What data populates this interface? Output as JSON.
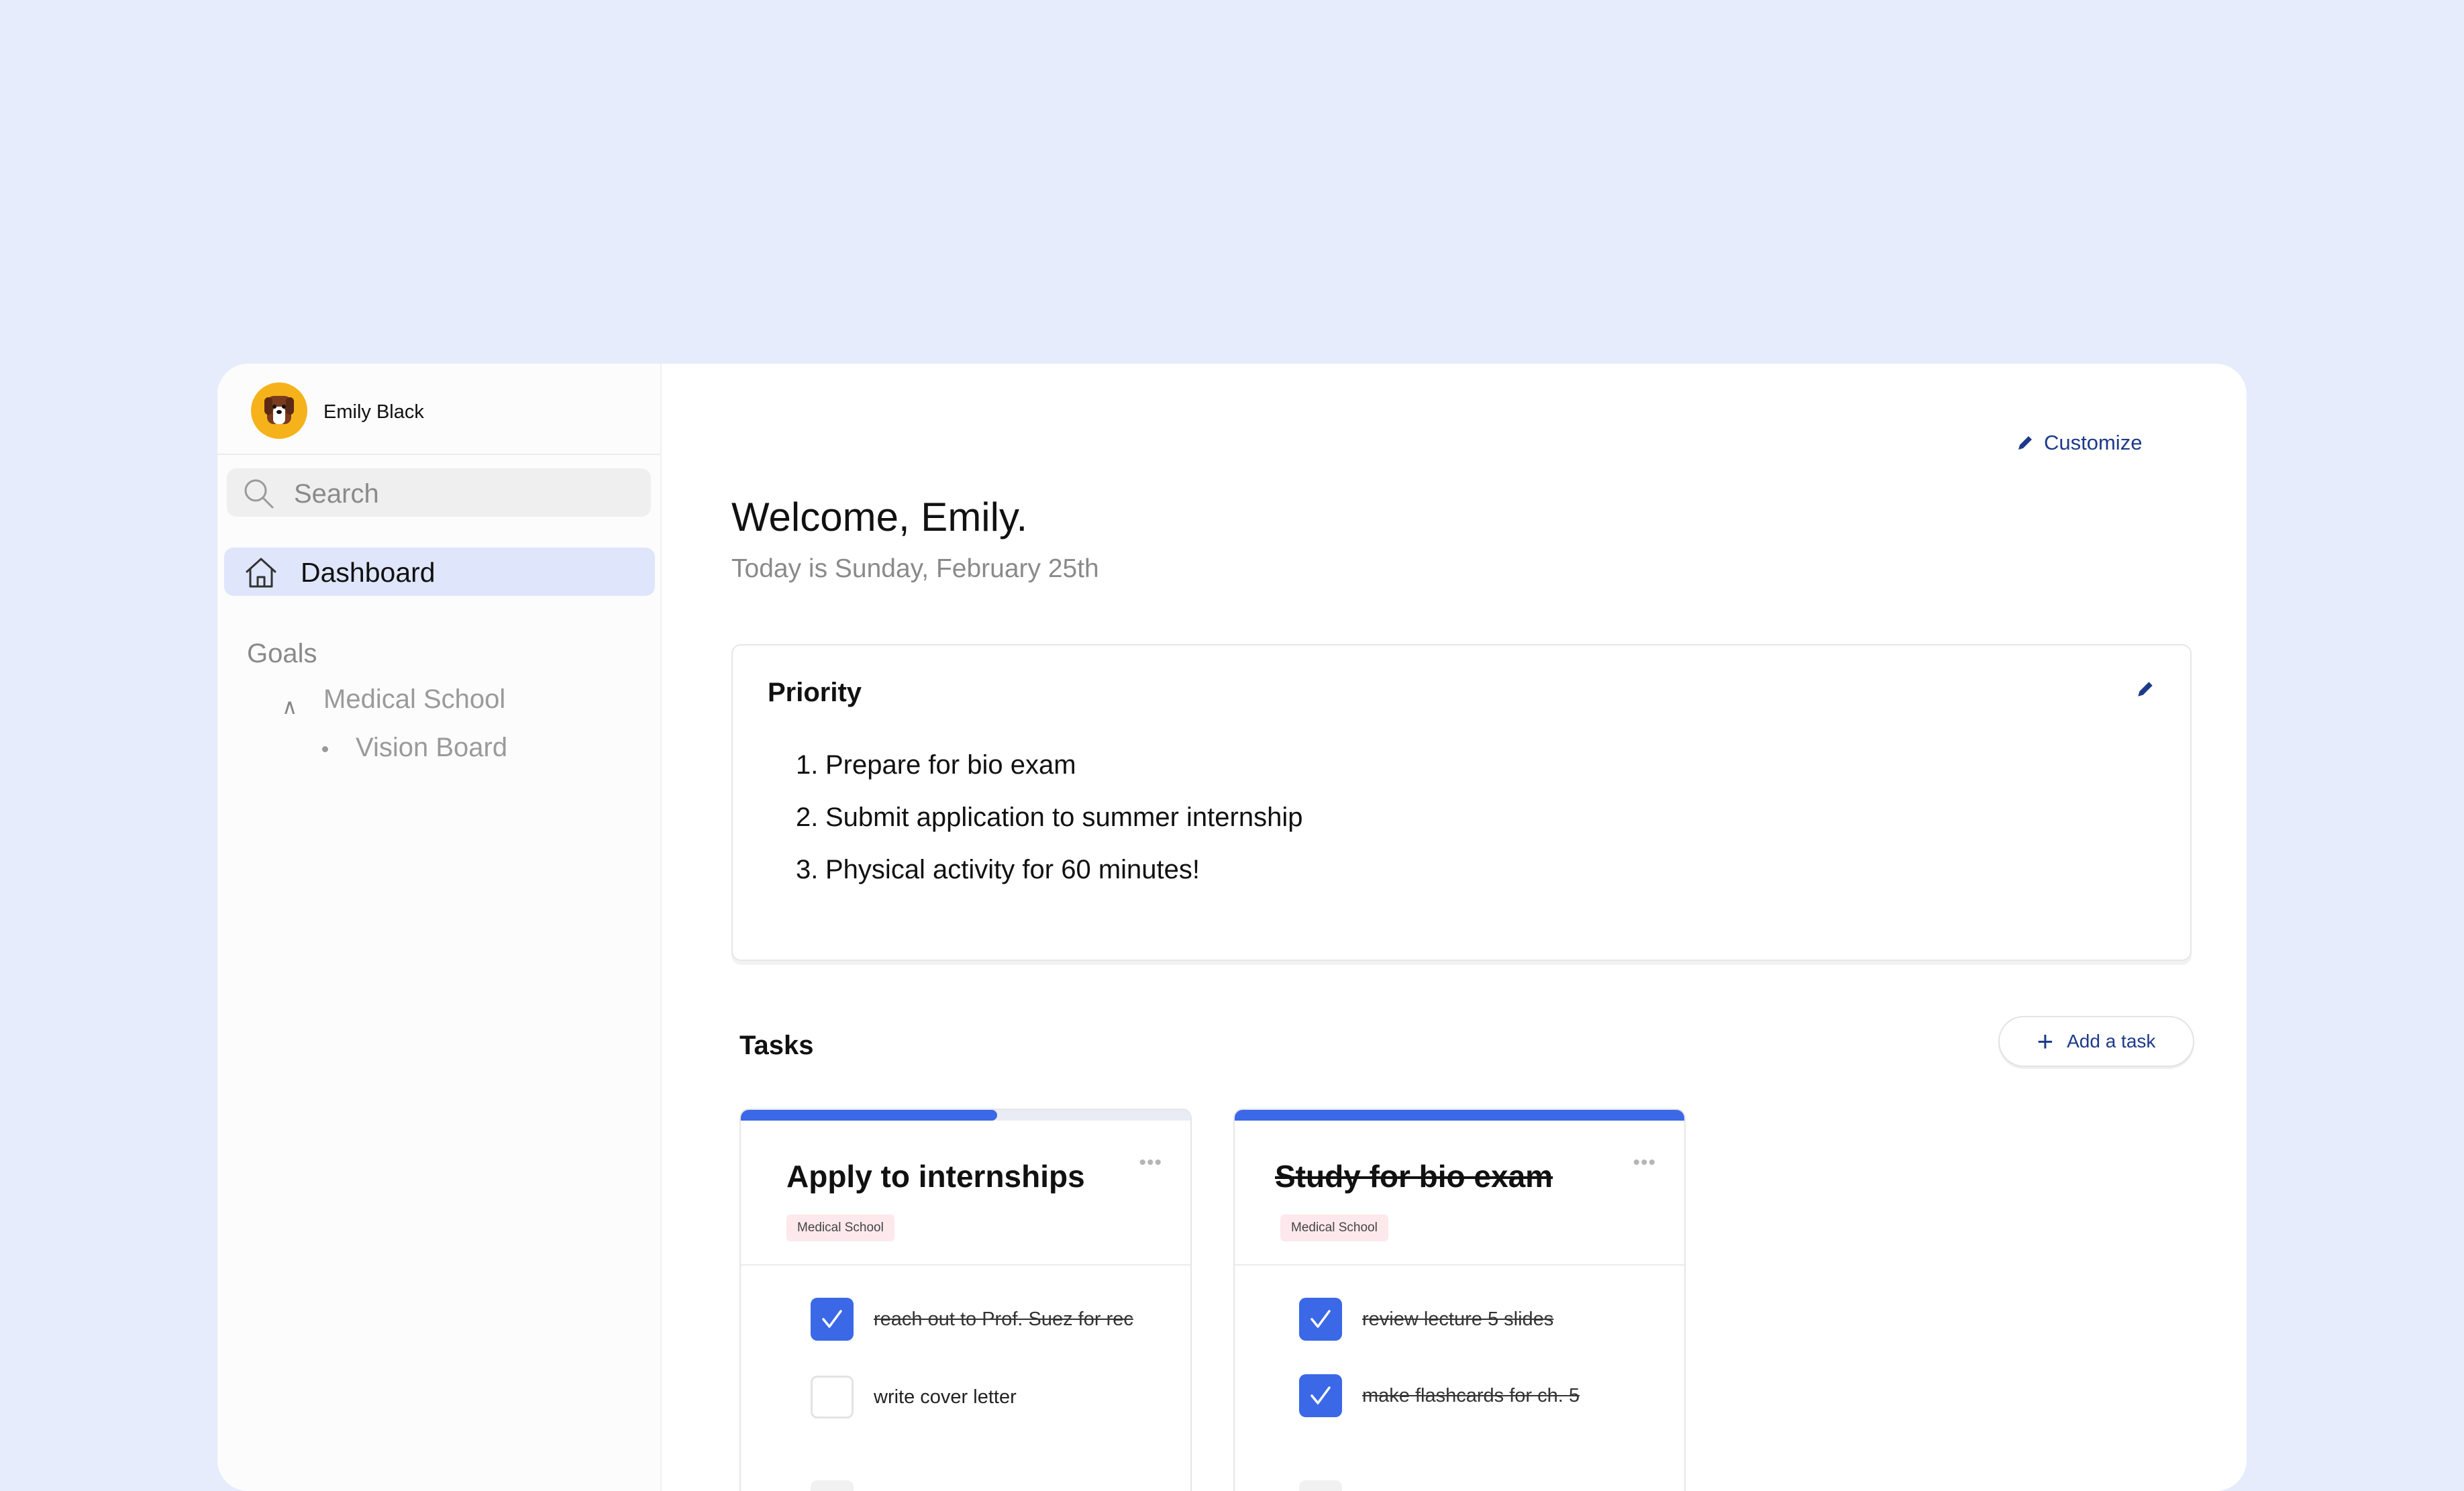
{
  "sidebar": {
    "user_name": "Emily Black",
    "search_placeholder": "Search",
    "nav": {
      "dashboard_label": "Dashboard"
    },
    "goals_label": "Goals",
    "goals": [
      {
        "label": "Medical School",
        "expanded": true,
        "children": [
          {
            "label": "Vision Board"
          }
        ]
      }
    ]
  },
  "header": {
    "customize_label": "Customize",
    "welcome": "Welcome, Emily.",
    "date_text": "Today is Sunday, February 25th"
  },
  "priority": {
    "title": "Priority",
    "items": [
      {
        "num": "1.",
        "text": "Prepare for bio exam"
      },
      {
        "num": "2.",
        "text": "Submit application to summer internship"
      },
      {
        "num": "3.",
        "text": "Physical activity for 60 minutes!"
      }
    ]
  },
  "tasks": {
    "title": "Tasks",
    "add_label": "Add a task",
    "cards": [
      {
        "title": "Apply to internships",
        "tag": "Medical School",
        "completed": false,
        "progress": 0.57,
        "items": [
          {
            "text": "reach out to Prof. Suez for rec",
            "done": true
          },
          {
            "text": "write cover letter",
            "done": false
          }
        ]
      },
      {
        "title": "Study for bio exam",
        "tag": "Medical School",
        "completed": true,
        "progress": 1.0,
        "items": [
          {
            "text": "review lecture 5 slides",
            "done": true
          },
          {
            "text": "make flashcards for ch. 5",
            "done": true
          }
        ]
      }
    ]
  },
  "colors": {
    "background": "#e6ecfb",
    "accent": "#3b68e6",
    "link": "#1d3a8a",
    "nav_active": "#dfe6fb",
    "tag_bg": "#fde8ec",
    "avatar": "#f6b21b"
  },
  "icons": [
    "avatar-dog-icon",
    "search-icon",
    "home-icon",
    "chevron-up-icon",
    "pencil-icon",
    "plus-icon",
    "more-icon",
    "checkmark-icon"
  ]
}
